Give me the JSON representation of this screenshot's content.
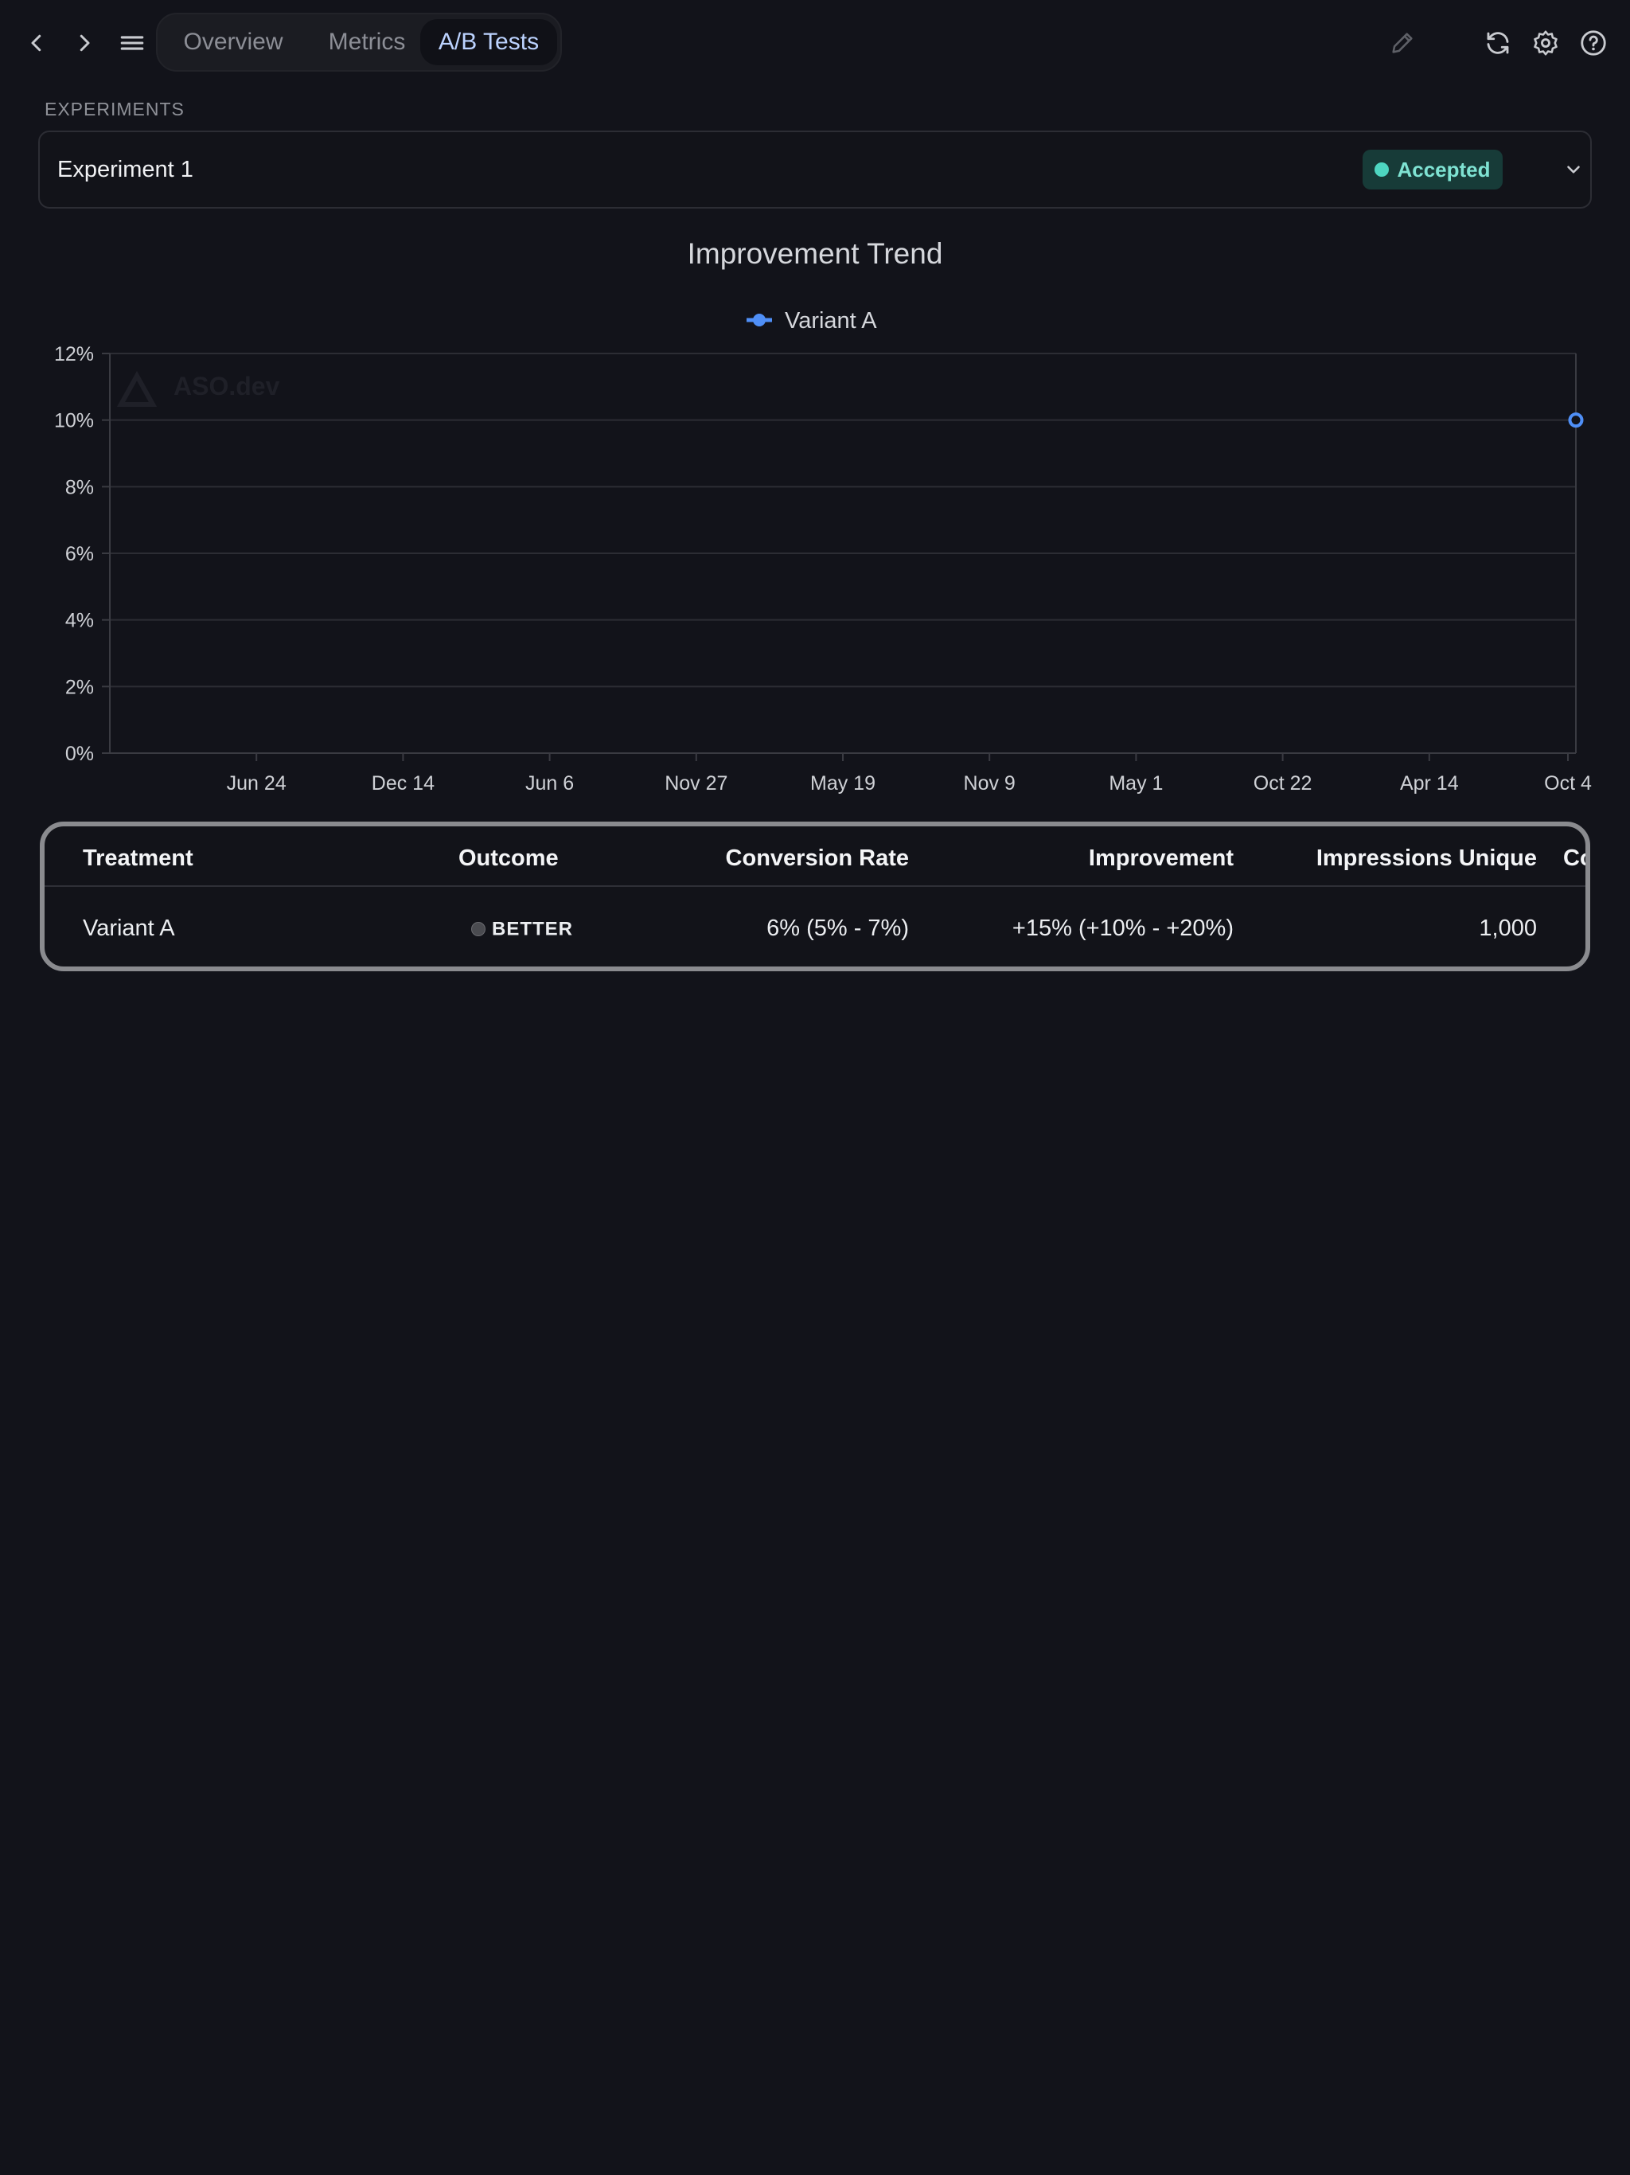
{
  "nav": {
    "tabs": [
      {
        "label": "Overview",
        "active": false
      },
      {
        "label": "Metrics",
        "active": false
      },
      {
        "label": "A/B Tests",
        "active": true
      }
    ]
  },
  "experiments": {
    "section_label": "EXPERIMENTS",
    "selected": "Experiment 1",
    "status": "Accepted"
  },
  "chart_data": {
    "type": "line",
    "title": "Improvement Trend",
    "x_tick_labels": [
      "Jun 24",
      "Dec 14",
      "Jun 6",
      "Nov 27",
      "May 19",
      "Nov 9",
      "May 1",
      "Oct 22",
      "Apr 14",
      "Oct 4"
    ],
    "y_tick_labels": [
      "0%",
      "2%",
      "4%",
      "6%",
      "8%",
      "10%",
      "12%"
    ],
    "ylim": [
      0,
      12
    ],
    "grid": true,
    "legend": "top-center",
    "series": [
      {
        "name": "Variant A",
        "color": "#4f8ff7",
        "points": [
          {
            "x": "Oct 4",
            "y": 10
          }
        ]
      }
    ],
    "watermark": "ASO.dev"
  },
  "table": {
    "headers": [
      "Treatment",
      "Outcome",
      "Conversion Rate",
      "Improvement",
      "Impressions Unique",
      "Co"
    ],
    "rows": [
      {
        "treatment": "Variant A",
        "outcome": "BETTER",
        "conversion_rate": "6% (5% - 7%)",
        "improvement": "+15% (+10% - +20%)",
        "impressions_unique": "1,000"
      }
    ]
  },
  "colors": {
    "background": "#12131a",
    "accent": "#4f8ff7",
    "accepted": "#7fe3d3"
  }
}
